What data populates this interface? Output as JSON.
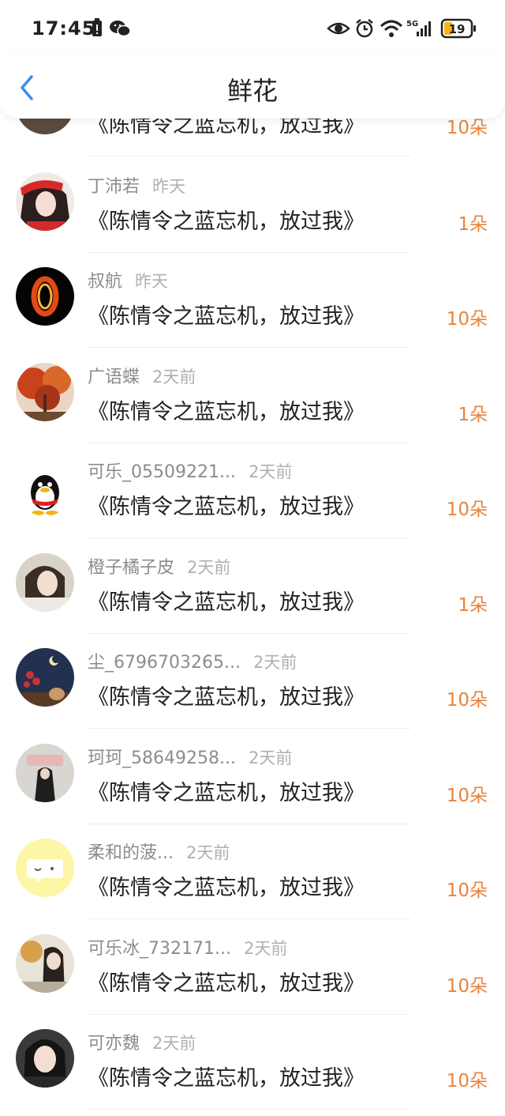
{
  "status_bar": {
    "time": "17:45",
    "battery": "19",
    "network": "5G"
  },
  "header": {
    "title": "鲜花"
  },
  "items": [
    {
      "name": "",
      "when": "",
      "message": "《陈情令之蓝忘机，放过我》",
      "count": "10朵"
    },
    {
      "name": "丁沛若",
      "when": "昨天",
      "message": "《陈情令之蓝忘机，放过我》",
      "count": "1朵"
    },
    {
      "name": "叔航",
      "when": "昨天",
      "message": "《陈情令之蓝忘机，放过我》",
      "count": "10朵"
    },
    {
      "name": "广语蝶",
      "when": "2天前",
      "message": "《陈情令之蓝忘机，放过我》",
      "count": "1朵"
    },
    {
      "name": "可乐_05509221...",
      "when": "2天前",
      "message": "《陈情令之蓝忘机，放过我》",
      "count": "10朵"
    },
    {
      "name": "橙子橘子皮",
      "when": "2天前",
      "message": "《陈情令之蓝忘机，放过我》",
      "count": "1朵"
    },
    {
      "name": "尘_6796703265...",
      "when": "2天前",
      "message": "《陈情令之蓝忘机，放过我》",
      "count": "10朵"
    },
    {
      "name": "珂珂_58649258...",
      "when": "2天前",
      "message": "《陈情令之蓝忘机，放过我》",
      "count": "10朵"
    },
    {
      "name": "柔和的菠...",
      "when": "2天前",
      "message": "《陈情令之蓝忘机，放过我》",
      "count": "10朵"
    },
    {
      "name": "可乐冰_732171...",
      "when": "2天前",
      "message": "《陈情令之蓝忘机，放过我》",
      "count": "10朵"
    },
    {
      "name": "可亦魏",
      "when": "2天前",
      "message": "《陈情令之蓝忘机，放过我》",
      "count": "10朵"
    }
  ]
}
